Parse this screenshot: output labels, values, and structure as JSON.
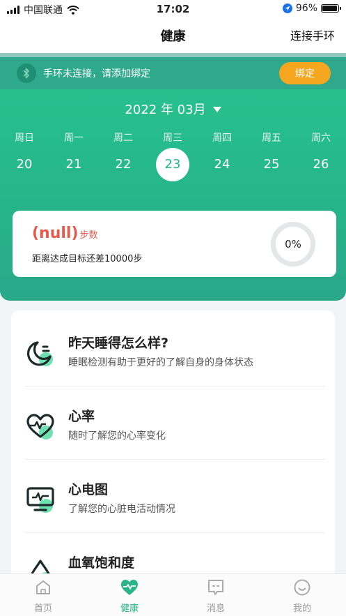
{
  "status_bar": {
    "carrier": "中国联通",
    "time": "17:02",
    "battery": "96%",
    "battery_level": 0.96
  },
  "nav": {
    "title": "健康",
    "right_action": "连接手环"
  },
  "device": {
    "message": "手环未连接，请添加绑定",
    "bind_label": "绑定"
  },
  "calendar": {
    "month_label": "2022 年 03月",
    "weekdays": [
      "周日",
      "周一",
      "周二",
      "周三",
      "周四",
      "周五",
      "周六"
    ],
    "dates": [
      "20",
      "21",
      "22",
      "23",
      "24",
      "25",
      "26"
    ],
    "selected_index": 3
  },
  "steps": {
    "value": "(null)",
    "unit": "步数",
    "goal_text": "距离达成目标还差10000步",
    "progress": "0%"
  },
  "health_items": [
    {
      "title": "昨天睡得怎么样?",
      "subtitle": "睡眠检测有助于更好的了解自身的身体状态",
      "icon": "sleep-icon"
    },
    {
      "title": "心率",
      "subtitle": "随时了解您的心率变化",
      "icon": "heart-rate-icon"
    },
    {
      "title": "心电图",
      "subtitle": "了解您的心脏电活动情况",
      "icon": "ecg-icon"
    },
    {
      "title": "血氧饱和度",
      "subtitle": "",
      "icon": "blood-oxygen-icon"
    }
  ],
  "tabs": [
    {
      "label": "首页",
      "icon": "home-icon"
    },
    {
      "label": "健康",
      "icon": "health-heart-icon",
      "active": true
    },
    {
      "label": "消息",
      "icon": "message-icon"
    },
    {
      "label": "我的",
      "icon": "profile-icon"
    }
  ],
  "colors": {
    "primary": "#28b386",
    "accent": "#f6a61f",
    "alert": "#e65a4b"
  }
}
